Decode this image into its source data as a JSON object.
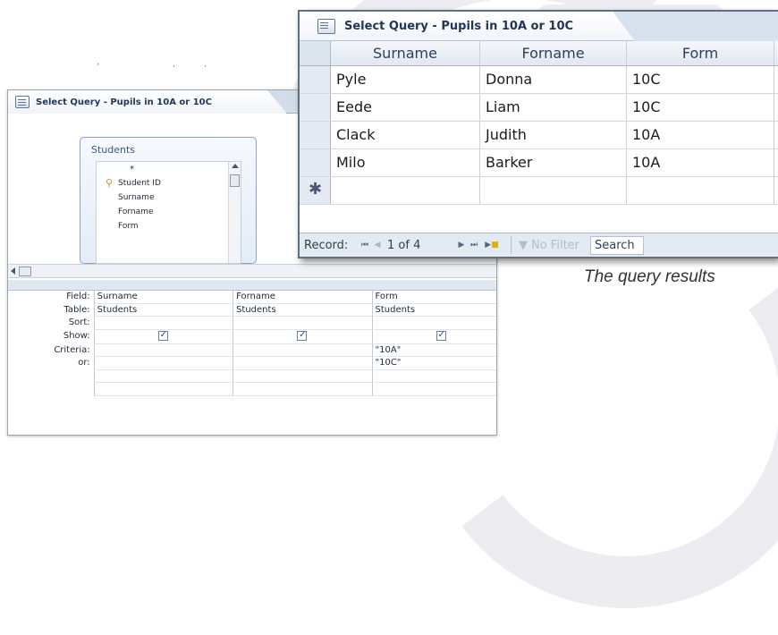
{
  "back_window": {
    "title": "Select Query - Pupils in 10A or 10C",
    "field_list": {
      "table_name": "Students",
      "items": [
        "*",
        "Student ID",
        "Surname",
        "Forname",
        "Form"
      ],
      "primary_key": "Student ID"
    },
    "grid": {
      "row_labels": [
        "Field:",
        "Table:",
        "Sort:",
        "Show:",
        "Criteria:",
        "or:"
      ],
      "columns": [
        {
          "field": "Surname",
          "table": "Students",
          "sort": "",
          "show": true,
          "criteria": "",
          "or": ""
        },
        {
          "field": "Forname",
          "table": "Students",
          "sort": "",
          "show": true,
          "criteria": "",
          "or": ""
        },
        {
          "field": "Form",
          "table": "Students",
          "sort": "",
          "show": true,
          "criteria": "\"10A\"",
          "or": "\"10C\""
        }
      ]
    }
  },
  "front_window": {
    "title": "Select Query - Pupils in 10A or 10C",
    "columns": [
      "Surname",
      "Forname",
      "Form"
    ],
    "rows": [
      [
        "Pyle",
        "Donna",
        "10C"
      ],
      [
        "Eede",
        "Liam",
        "10C"
      ],
      [
        "Clack",
        "Judith",
        "10A"
      ],
      [
        "Milo",
        "Barker",
        "10A"
      ]
    ],
    "new_row_marker": "✱",
    "navigation": {
      "label": "Record:",
      "position": "1 of 4",
      "filter": "No Filter",
      "search": "Search"
    }
  },
  "caption": "The query results",
  "stray_marks": [
    "ʼ",
    "ʼ",
    "ʼ"
  ]
}
